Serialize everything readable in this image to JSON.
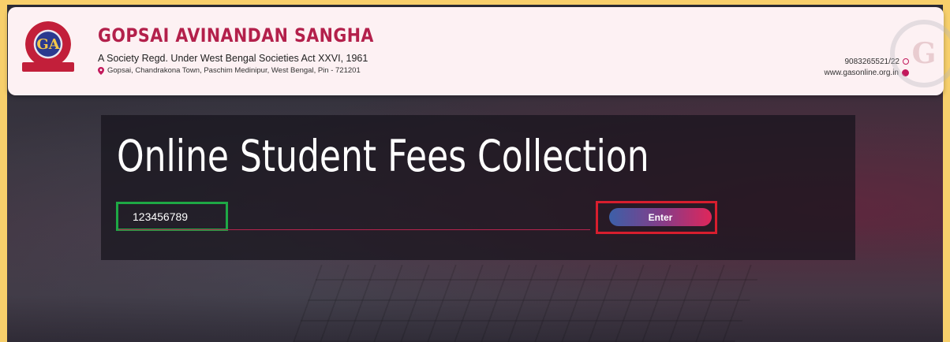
{
  "header": {
    "logo_text": "GA",
    "org_name": "GOPSAI AVINANDAN SANGHA",
    "subtitle": "A Society Regd. Under West Bengal Societies Act XXVI, 1961",
    "address": "Gopsai, Chandrakona Town, Paschim Medinipur, West Bengal, Pin - 721201",
    "phone": "9083265521/22",
    "website": "www.gasonline.org.in"
  },
  "main": {
    "title": "Online Student Fees Collection",
    "student_id_value": "123456789",
    "enter_label": "Enter"
  },
  "colors": {
    "brand": "#b3204b",
    "accent_green": "#1ea845",
    "accent_red": "#d81e2e"
  }
}
